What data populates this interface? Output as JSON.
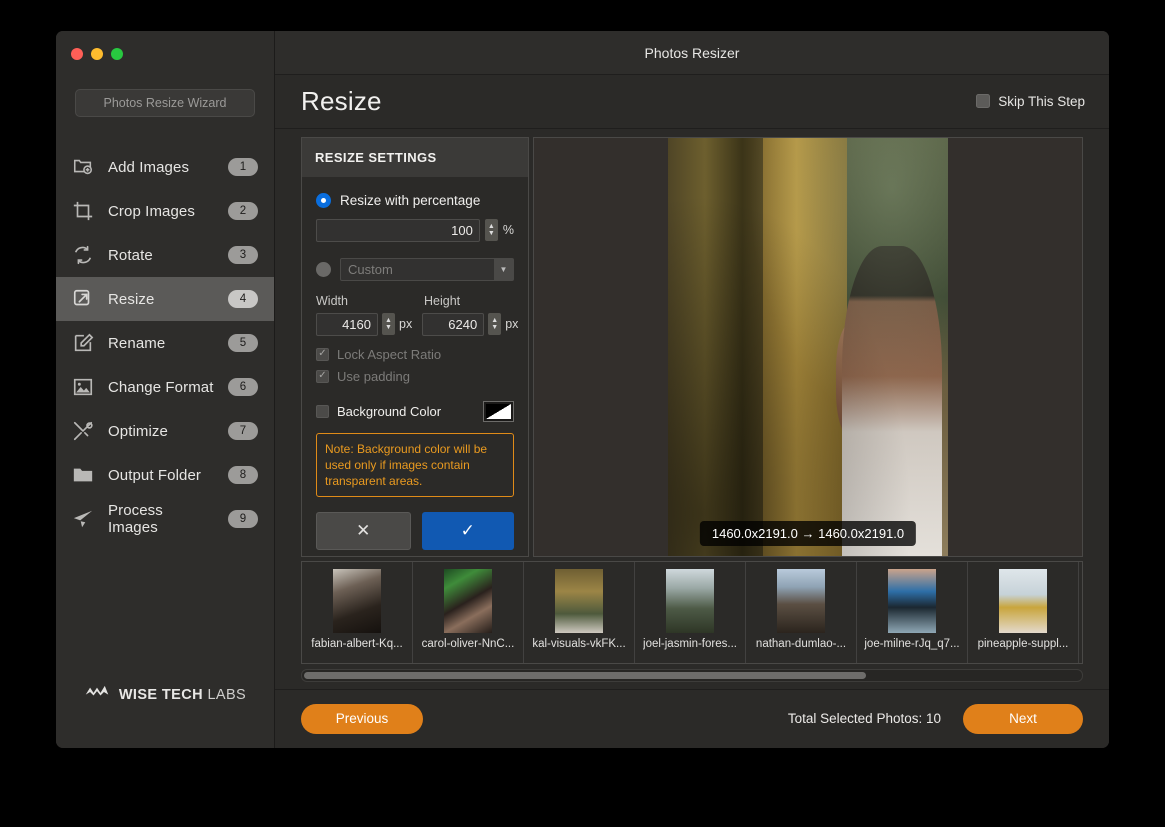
{
  "window": {
    "title": "Photos Resizer",
    "traffic_lights": [
      "close-red",
      "minimize-yellow",
      "zoom-green"
    ]
  },
  "sidebar": {
    "wizard_button": "Photos Resize Wizard",
    "items": [
      {
        "label": "Add Images",
        "badge": "1",
        "icon": "add-image-icon",
        "active": false
      },
      {
        "label": "Crop Images",
        "badge": "2",
        "icon": "crop-icon",
        "active": false
      },
      {
        "label": "Rotate",
        "badge": "3",
        "icon": "rotate-icon",
        "active": false
      },
      {
        "label": "Resize",
        "badge": "4",
        "icon": "resize-icon",
        "active": true
      },
      {
        "label": "Rename",
        "badge": "5",
        "icon": "rename-icon",
        "active": false
      },
      {
        "label": "Change Format",
        "badge": "6",
        "icon": "image-format-icon",
        "active": false
      },
      {
        "label": "Optimize",
        "badge": "7",
        "icon": "tools-icon",
        "active": false
      },
      {
        "label": "Output Folder",
        "badge": "8",
        "icon": "folder-icon",
        "active": false
      },
      {
        "label": "Process Images",
        "badge": "9",
        "icon": "send-icon",
        "active": false
      }
    ],
    "brand": {
      "bold_text": "WISE TECH",
      "light_text": "LABS",
      "icon": "wise-tech-labs-logo"
    }
  },
  "page": {
    "title": "Resize",
    "skip_label": "Skip This Step",
    "skip_checked": false
  },
  "settings": {
    "header": "RESIZE SETTINGS",
    "percentage_option": {
      "label": "Resize with percentage",
      "selected": true,
      "value": "100",
      "unit": "%"
    },
    "dimension_option": {
      "selected": false,
      "preset": "Custom",
      "width_label": "Width",
      "width_value": "4160",
      "height_label": "Height",
      "height_value": "6240",
      "unit": "px"
    },
    "lock_aspect": {
      "label": "Lock Aspect Ratio",
      "checked": true,
      "enabled": false
    },
    "use_padding": {
      "label": "Use padding",
      "checked": true,
      "enabled": false
    },
    "background_color": {
      "label": "Background Color",
      "checked": false,
      "swatch": "black-white-diagonal"
    },
    "note": "Note: Background color will be used only if images contain transparent areas.",
    "note_color": "#e99a20",
    "cancel_button": "✕",
    "apply_button": "✓",
    "apply_color": "#1159b2"
  },
  "preview": {
    "dimension_badge": "1460.0x2191.0 → 1460.0x2191.0",
    "image_alt": "woman behind bamboo stalks"
  },
  "thumbnails": [
    {
      "name": "fabian-albert-Kq...",
      "class": "t1"
    },
    {
      "name": "carol-oliver-NnC...",
      "class": "t2"
    },
    {
      "name": "kal-visuals-vkFK...",
      "class": "t3"
    },
    {
      "name": "joel-jasmin-fores...",
      "class": "t4"
    },
    {
      "name": "nathan-dumlao-...",
      "class": "t5"
    },
    {
      "name": "joe-milne-rJq_q7...",
      "class": "t6"
    },
    {
      "name": "pineapple-suppl...",
      "class": "t7"
    }
  ],
  "scrollbar": {
    "thumb_percent": 72
  },
  "footer": {
    "previous_label": "Previous",
    "next_label": "Next",
    "total_label": "Total Selected Photos: 10",
    "accent_color": "#e0801a"
  }
}
